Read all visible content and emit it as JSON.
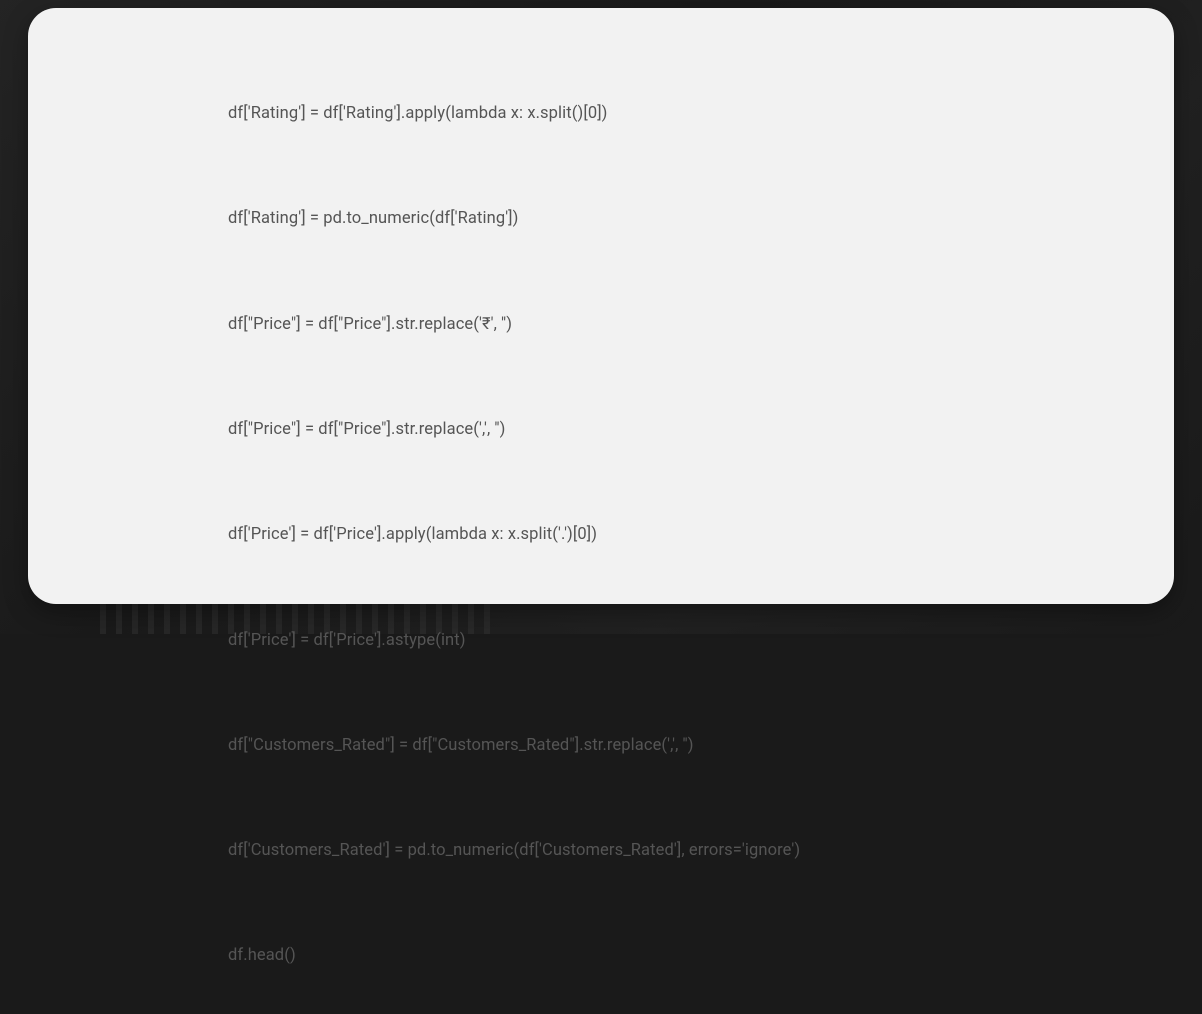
{
  "code": {
    "lines": [
      "df['Rating'] = df['Rating'].apply(lambda x: x.split()[0])",
      "df['Rating'] = pd.to_numeric(df['Rating'])",
      "df[\"Price\"] = df[\"Price\"].str.replace('₹', '')",
      "df[\"Price\"] = df[\"Price\"].str.replace(',', '')",
      "df['Price'] = df['Price'].apply(lambda x: x.split('.')[0])",
      "df['Price'] = df['Price'].astype(int)",
      "df[\"Customers_Rated\"] = df[\"Customers_Rated\"].str.replace(',', '')",
      "df['Customers_Rated'] = pd.to_numeric(df['Customers_Rated'], errors='ignore')",
      "df.head()"
    ]
  }
}
